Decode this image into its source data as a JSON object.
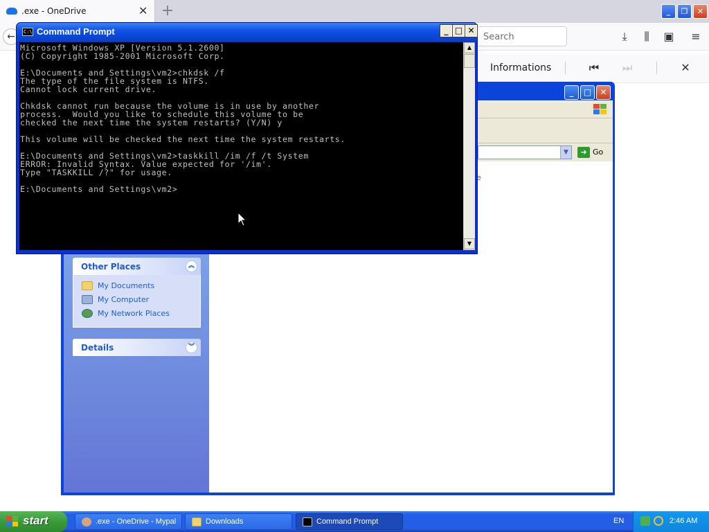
{
  "browser": {
    "tab_title": ".exe - OneDrive",
    "tab_close": "✕",
    "new_tab": "+",
    "search_placeholder": "Search",
    "info_label": "Informations",
    "close_panel": "✕"
  },
  "explorer": {
    "go_label": "Go",
    "other_places": {
      "title": "Other Places",
      "items": [
        {
          "label": "My Documents",
          "icon": "folder-icon"
        },
        {
          "label": "My Computer",
          "icon": "computer-icon"
        },
        {
          "label": "My Network Places",
          "icon": "network-icon"
        }
      ]
    },
    "details": {
      "title": "Details"
    },
    "ghost_char": "e"
  },
  "cmd": {
    "title": "Command Prompt",
    "lines": [
      "Microsoft Windows XP [Version 5.1.2600]",
      "(C) Copyright 1985-2001 Microsoft Corp.",
      "",
      "E:\\Documents and Settings\\vm2>chkdsk /f",
      "The type of the file system is NTFS.",
      "Cannot lock current drive.",
      "",
      "Chkdsk cannot run because the volume is in use by another",
      "process.  Would you like to schedule this volume to be",
      "checked the next time the system restarts? (Y/N) y",
      "",
      "This volume will be checked the next time the system restarts.",
      "",
      "E:\\Documents and Settings\\vm2>taskkill /im /f /t System",
      "ERROR: Invalid Syntax. Value expected for '/im'.",
      "Type \"TASKKILL /?\" for usage.",
      "",
      "E:\\Documents and Settings\\vm2>"
    ]
  },
  "taskbar": {
    "start_label": "start",
    "items": [
      {
        "label": ".exe - OneDrive - Mypal",
        "icon": "mypal-icon"
      },
      {
        "label": "Downloads",
        "icon": "folder-icon"
      },
      {
        "label": "Command Prompt",
        "icon": "cmd-icon"
      }
    ],
    "language": "EN",
    "clock": "2:46 AM"
  }
}
